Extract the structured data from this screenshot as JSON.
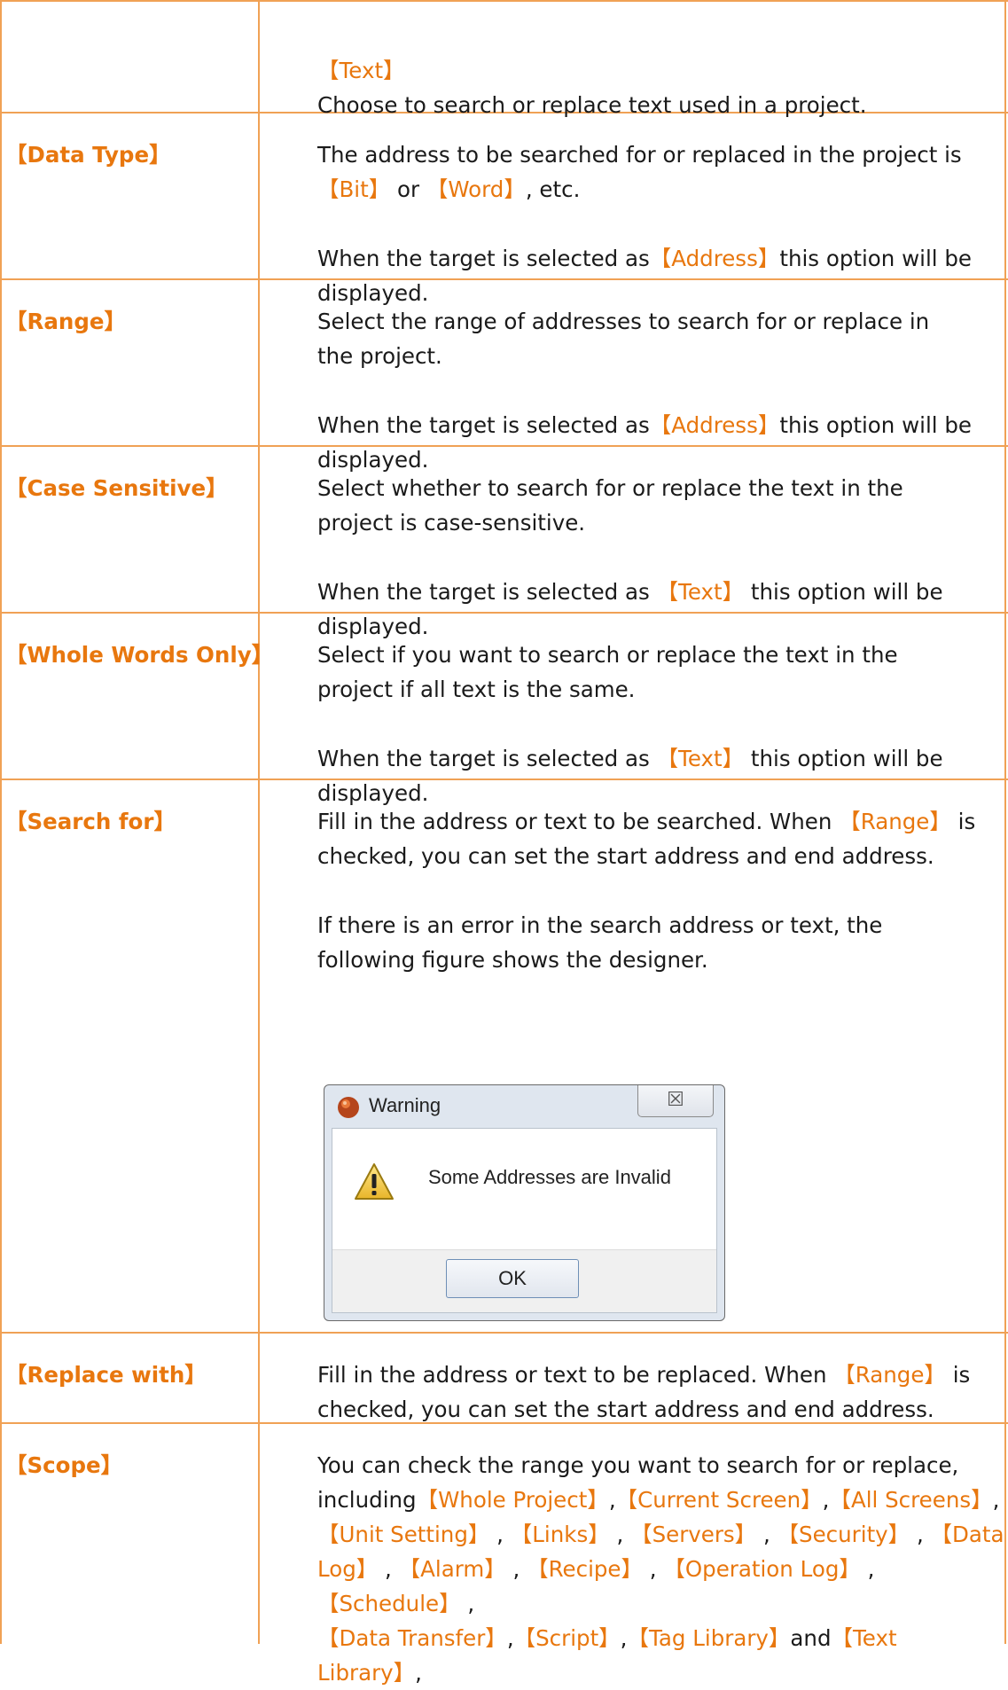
{
  "rows": [
    {
      "label": "",
      "lines": [
        [
          {
            "t": "【Text】",
            "hl": true
          }
        ],
        [
          {
            "t": "Choose to search or replace text used in a project.",
            "hl": false
          }
        ]
      ]
    },
    {
      "label": "【Data Type】",
      "lines": [
        [
          {
            "t": "The address to be searched for or replaced in the project is",
            "hl": false
          }
        ],
        [
          {
            "t": "【Bit】",
            "hl": true
          },
          {
            "t": " or ",
            "hl": false
          },
          {
            "t": "【Word】",
            "hl": true
          },
          {
            "t": ", etc.",
            "hl": false
          }
        ],
        [],
        [
          {
            "t": "When the target is selected as",
            "hl": false
          },
          {
            "t": "【Address】",
            "hl": true
          },
          {
            "t": "this option will be",
            "hl": false
          }
        ],
        [
          {
            "t": "displayed.",
            "hl": false
          }
        ]
      ]
    },
    {
      "label": "【Range】",
      "lines": [
        [
          {
            "t": "Select the range of addresses to search for or replace in",
            "hl": false
          }
        ],
        [
          {
            "t": "the project.",
            "hl": false
          }
        ],
        [],
        [
          {
            "t": "When the target is selected as",
            "hl": false
          },
          {
            "t": "【Address】",
            "hl": true
          },
          {
            "t": "this option will be",
            "hl": false
          }
        ],
        [
          {
            "t": "displayed.",
            "hl": false
          }
        ]
      ]
    },
    {
      "label": "【Case Sensitive】",
      "lines": [
        [
          {
            "t": "Select whether to search for or replace the text in the",
            "hl": false
          }
        ],
        [
          {
            "t": "project is case-sensitive.",
            "hl": false
          }
        ],
        [],
        [
          {
            "t": "When the target is selected as ",
            "hl": false
          },
          {
            "t": "【Text】",
            "hl": true
          },
          {
            "t": " this option will be",
            "hl": false
          }
        ],
        [
          {
            "t": "displayed.",
            "hl": false
          }
        ]
      ]
    },
    {
      "label": "【Whole Words Only】",
      "lines": [
        [
          {
            "t": "Select if you want to search or replace the text in the",
            "hl": false
          }
        ],
        [
          {
            "t": "project if all text is the same.",
            "hl": false
          }
        ],
        [],
        [
          {
            "t": "When the target is selected as ",
            "hl": false
          },
          {
            "t": "【Text】",
            "hl": true
          },
          {
            "t": " this option will be",
            "hl": false
          }
        ],
        [
          {
            "t": "displayed.",
            "hl": false
          }
        ]
      ]
    },
    {
      "label": "【Search for】",
      "lines": [
        [
          {
            "t": "Fill in the address or text to be searched. When ",
            "hl": false
          },
          {
            "t": "【Range】",
            "hl": true
          },
          {
            "t": " is",
            "hl": false
          }
        ],
        [
          {
            "t": "checked, you can set the start address and end address.",
            "hl": false
          }
        ],
        [],
        [
          {
            "t": "If there is an error in the search address or text, the",
            "hl": false
          }
        ],
        [
          {
            "t": "following figure shows the designer.",
            "hl": false
          }
        ]
      ]
    },
    {
      "label": "【Replace with】",
      "lines": [
        [
          {
            "t": "Fill in the address or text to be replaced. When ",
            "hl": false
          },
          {
            "t": "【Range】",
            "hl": true
          },
          {
            "t": " is",
            "hl": false
          }
        ],
        [
          {
            "t": "checked, you can set the start address and end address.",
            "hl": false
          }
        ]
      ]
    },
    {
      "label": "【Scope】",
      "lines": [
        [
          {
            "t": "You can check the range you want to search for or replace,",
            "hl": false
          }
        ],
        [
          {
            "t": "including",
            "hl": false
          },
          {
            "t": "【Whole Project】",
            "hl": true
          },
          {
            "t": ",",
            "hl": false
          },
          {
            "t": "【Current Screen】",
            "hl": true
          },
          {
            "t": ",",
            "hl": false
          },
          {
            "t": "【All Screens】",
            "hl": true
          },
          {
            "t": ",",
            "hl": false
          }
        ],
        [
          {
            "t": "【Unit Setting】",
            "hl": true
          },
          {
            "t": " , ",
            "hl": false
          },
          {
            "t": "【Links】",
            "hl": true
          },
          {
            "t": " , ",
            "hl": false
          },
          {
            "t": "【Servers】",
            "hl": true
          },
          {
            "t": " , ",
            "hl": false
          },
          {
            "t": "【Security】",
            "hl": true
          },
          {
            "t": " , ",
            "hl": false
          },
          {
            "t": "【Data",
            "hl": true
          }
        ],
        [
          {
            "t": "Log】",
            "hl": true
          },
          {
            "t": " , ",
            "hl": false
          },
          {
            "t": "【Alarm】",
            "hl": true
          },
          {
            "t": " , ",
            "hl": false
          },
          {
            "t": "【Recipe】",
            "hl": true
          },
          {
            "t": " , ",
            "hl": false
          },
          {
            "t": "【Operation Log】",
            "hl": true
          },
          {
            "t": " , ",
            "hl": false
          },
          {
            "t": "【Schedule】",
            "hl": true
          },
          {
            "t": " ,",
            "hl": false
          }
        ],
        [
          {
            "t": "【Data Transfer】",
            "hl": true
          },
          {
            "t": ",",
            "hl": false
          },
          {
            "t": "【Script】",
            "hl": true
          },
          {
            "t": ",",
            "hl": false
          },
          {
            "t": "【Tag Library】",
            "hl": true
          },
          {
            "t": "and",
            "hl": false
          },
          {
            "t": "【Text Library】",
            "hl": true
          },
          {
            "t": ",",
            "hl": false
          }
        ]
      ]
    }
  ],
  "dialog": {
    "title": "Warning",
    "close_glyph": "☒",
    "message": "Some Addresses are Invalid",
    "ok_label": "OK",
    "icon": "warning-triangle-icon",
    "title_icon": "app-ball-icon"
  },
  "colors": {
    "border": "#f0a155",
    "accent": "#e8770e"
  }
}
